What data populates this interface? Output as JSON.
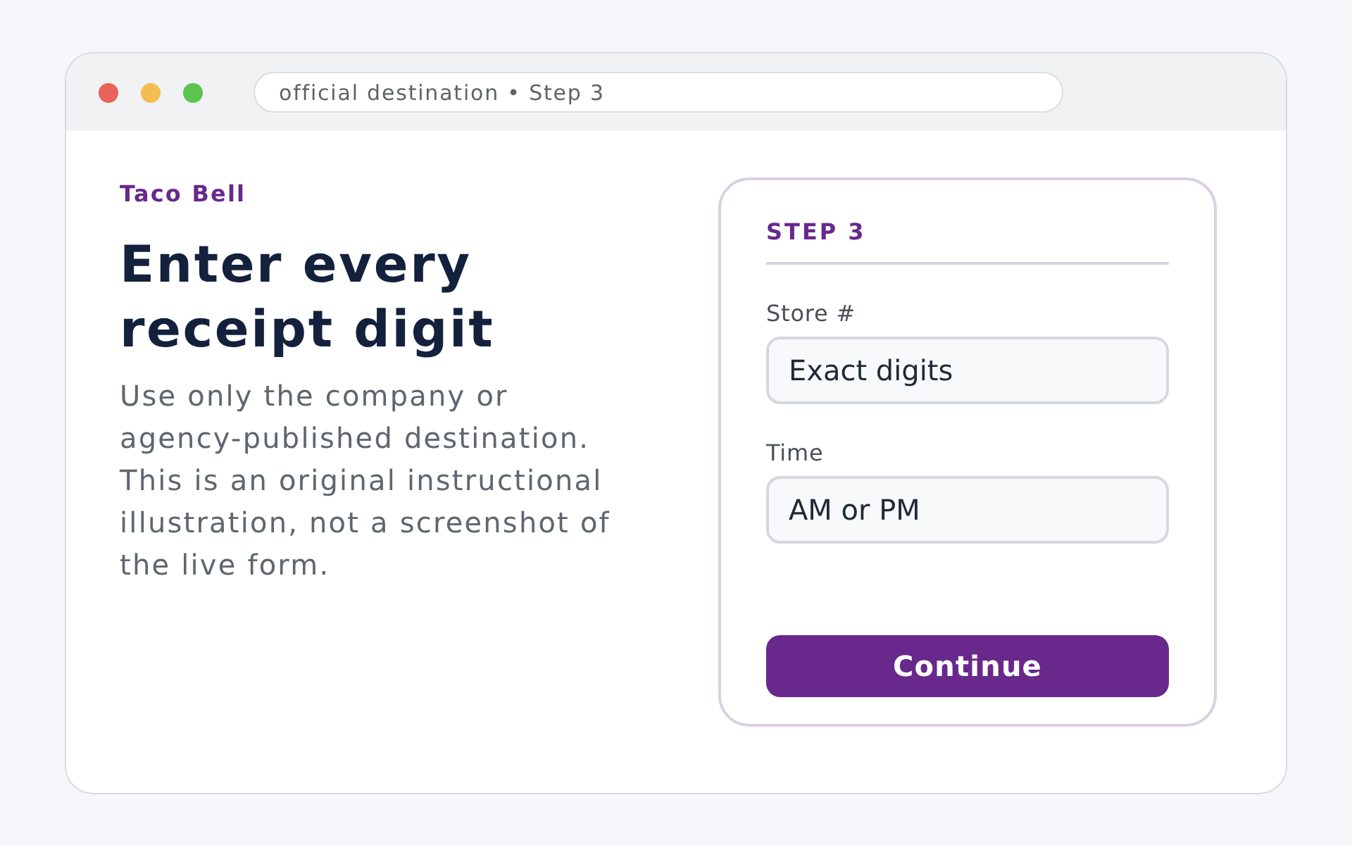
{
  "address_bar": {
    "text": "official destination • Step 3"
  },
  "intro": {
    "brand": "Taco Bell",
    "heading": "Enter every receipt digit",
    "description": "Use only the company or agency-published destination. This is an original instructional illustration, not a screenshot of the live form."
  },
  "form_card": {
    "step": "STEP 3",
    "fields": [
      {
        "label": "Store #",
        "value": "Exact digits"
      },
      {
        "label": "Time",
        "value": "AM or PM"
      }
    ],
    "button": "Continue"
  }
}
